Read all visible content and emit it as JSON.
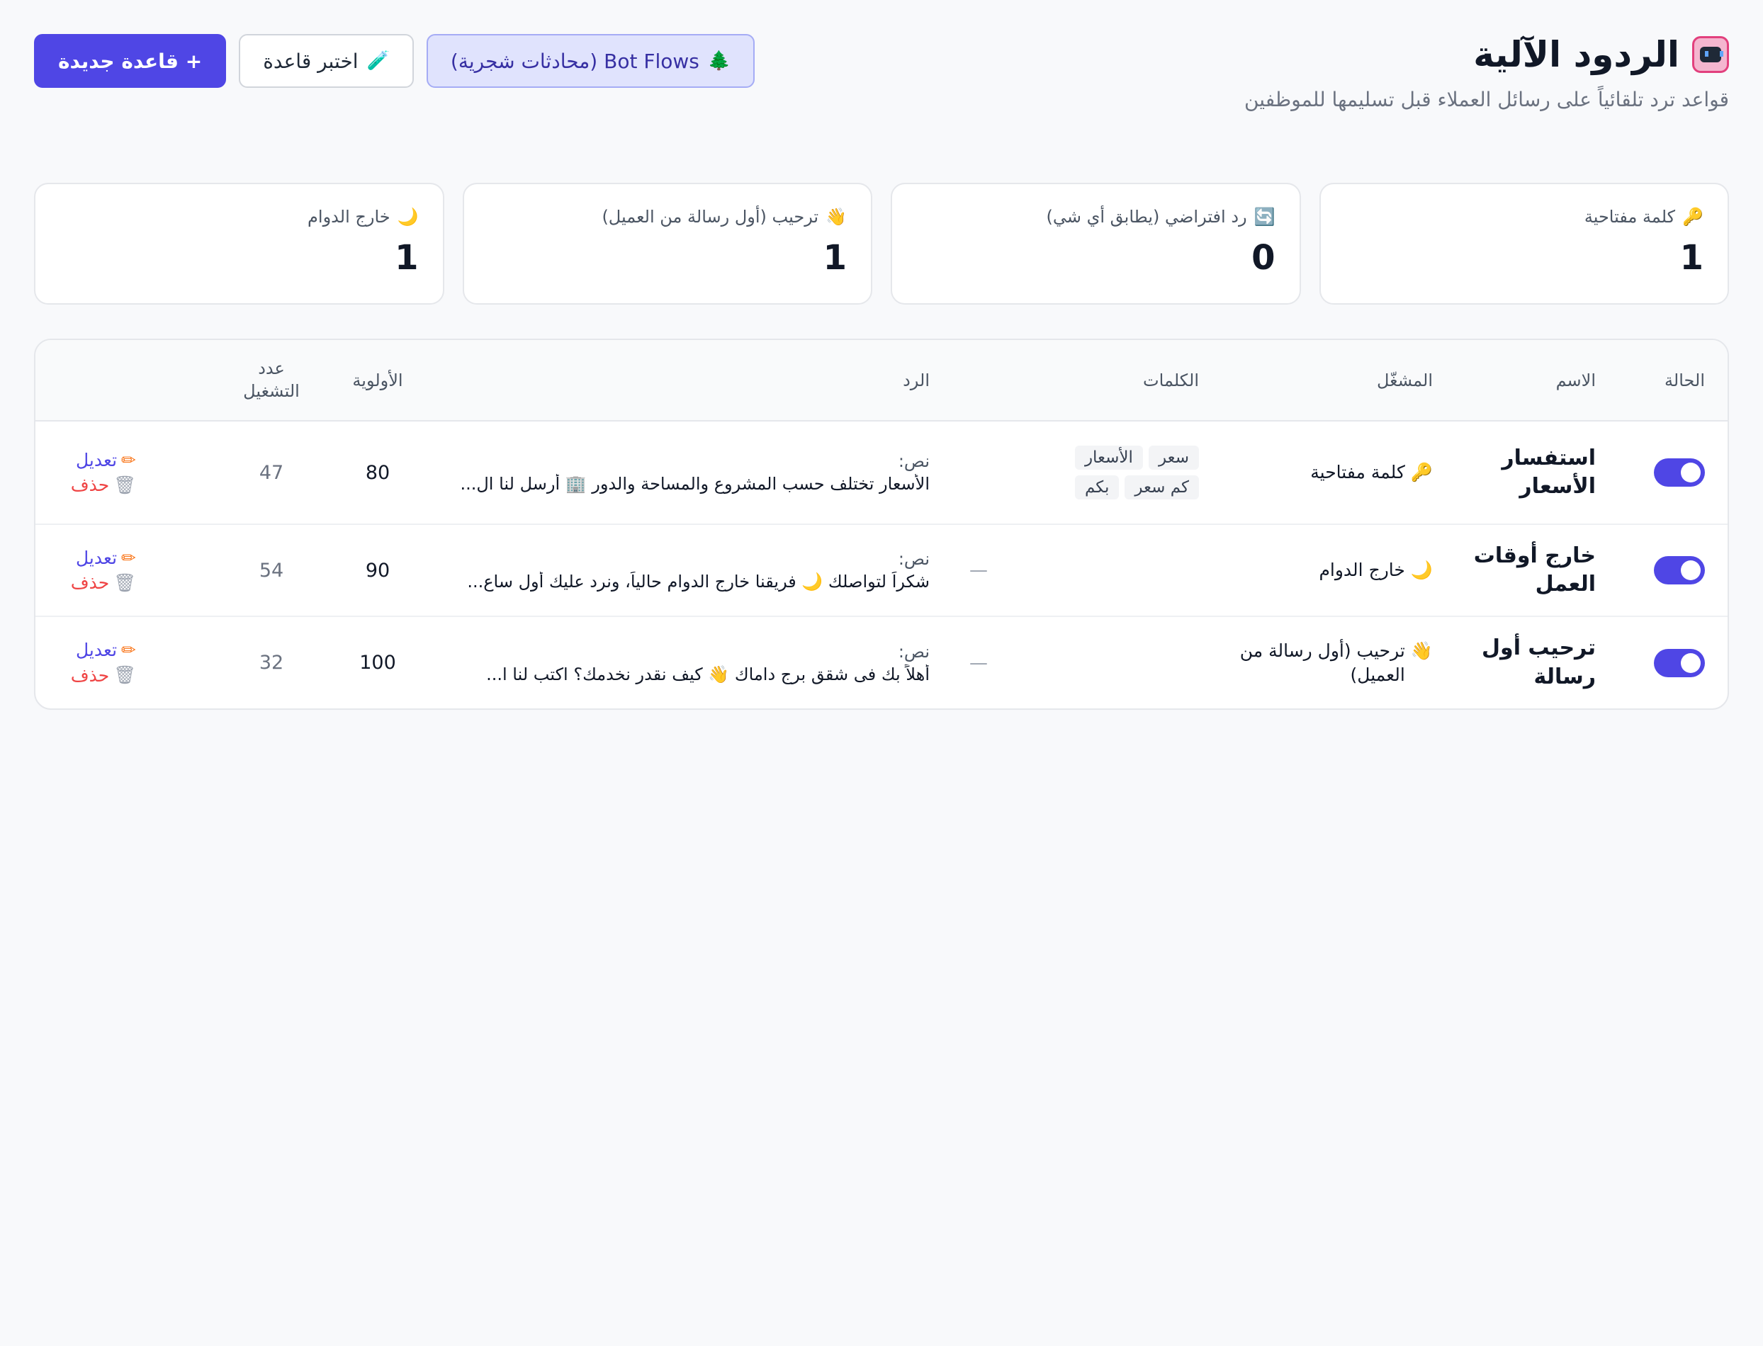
{
  "header": {
    "title": "الردود الآلية",
    "subtitle": "قواعد ترد تلقائياً على رسائل العملاء قبل تسليمها للموظفين",
    "icon": "robot-icon"
  },
  "actions": {
    "flows_label": "Bot Flows (محادثات شجرية)",
    "flows_icon": "🌲",
    "test_label": "اختبر قاعدة",
    "test_icon": "🧪",
    "new_label": "+ قاعدة جديدة"
  },
  "stats": [
    {
      "label": "كلمة مفتاحية",
      "icon": "🔑",
      "value": "1"
    },
    {
      "label": "رد افتراضي (يطابق أي شي)",
      "icon": "🔄",
      "value": "0"
    },
    {
      "label": "ترحيب (أول رسالة من العميل)",
      "icon": "👋",
      "value": "1"
    },
    {
      "label": "خارج الدوام",
      "icon": "🌙",
      "value": "1"
    }
  ],
  "table": {
    "headers": {
      "status": "الحالة",
      "name": "الاسم",
      "trigger": "المشغّل",
      "keywords": "الكلمات",
      "reply": "الرد",
      "priority": "الأولوية",
      "runs": "عدد التشغيل"
    },
    "rows": [
      {
        "enabled": true,
        "name": "استفسار الأسعار",
        "trigger_icon": "🔑",
        "trigger": "كلمة مفتاحية",
        "keywords": [
          "سعر",
          "الأسعار",
          "كم سعر",
          "بكم"
        ],
        "reply_type": "نص:",
        "reply_text": "الأسعار تختلف حسب المشروع والمساحة والدور 🏢 أرسل لنا ال...",
        "priority": "80",
        "runs": "47",
        "edit_label": "تعديل",
        "delete_label": "حذف"
      },
      {
        "enabled": true,
        "name": "خارج أوقات العمل",
        "trigger_icon": "🌙",
        "trigger": "خارج الدوام",
        "keywords_empty": "—",
        "reply_type": "نص:",
        "reply_text": "شكراً لتواصلك 🌙 فريقنا خارج الدوام حالياً، ونرد عليك أول ساع...",
        "priority": "90",
        "runs": "54",
        "edit_label": "تعديل",
        "delete_label": "حذف"
      },
      {
        "enabled": true,
        "name": "ترحيب أول رسالة",
        "trigger_icon": "👋",
        "trigger": "ترحيب (أول رسالة من العميل)",
        "keywords_empty": "—",
        "reply_type": "نص:",
        "reply_text": "أهلاً بك فى شقق برج داماك 👋 كيف نقدر نخدمك؟ اكتب لنا ا...",
        "priority": "100",
        "runs": "32",
        "edit_label": "تعديل",
        "delete_label": "حذف"
      }
    ]
  },
  "colors": {
    "accent": "#4f46e5",
    "delete": "#ef4444",
    "background": "#f8f9fb"
  }
}
